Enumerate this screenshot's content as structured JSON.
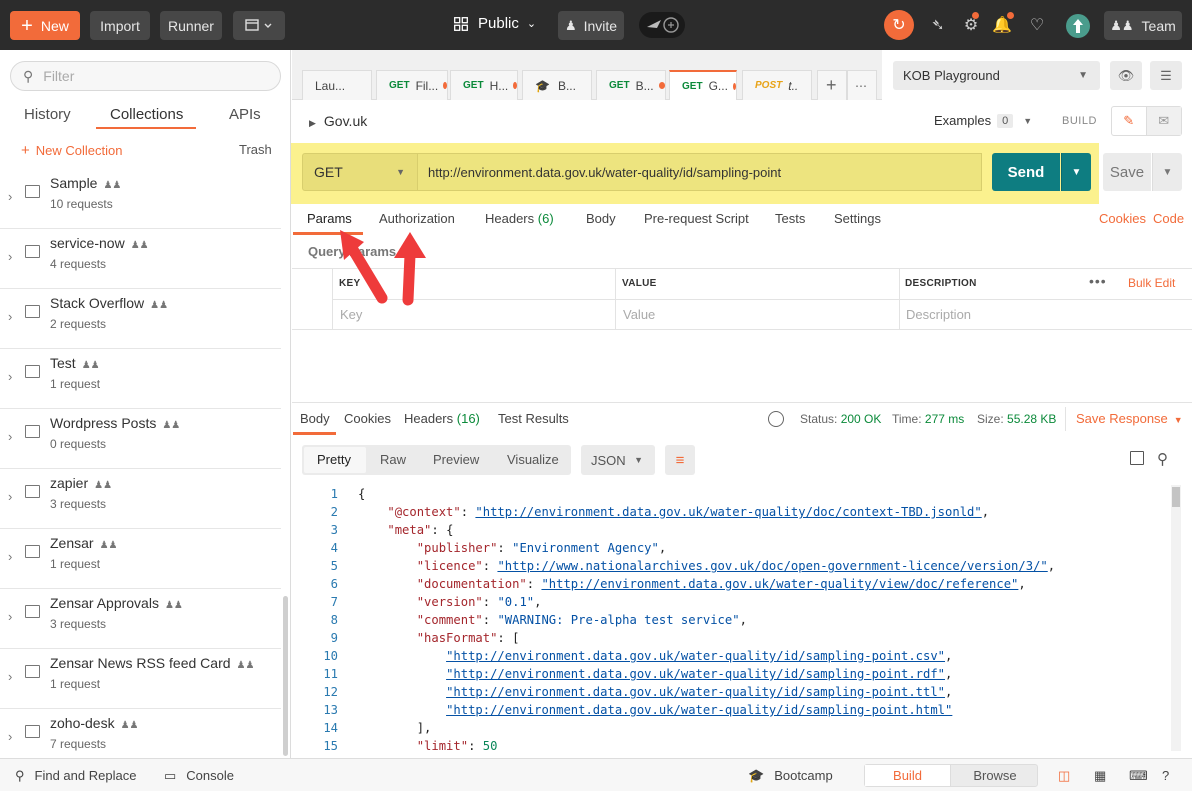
{
  "topbar": {
    "new_label": "New",
    "import_label": "Import",
    "runner_label": "Runner",
    "workspace_label": "Public",
    "invite_label": "Invite",
    "team_label": "Team",
    "accent": "#f26b3a"
  },
  "sidebar": {
    "filter_placeholder": "Filter",
    "tabs": [
      {
        "label": "History"
      },
      {
        "label": "Collections"
      },
      {
        "label": "APIs"
      }
    ],
    "new_collection_label": "New Collection",
    "trash_label": "Trash",
    "collections": [
      {
        "name": "Sample",
        "count": "10 requests"
      },
      {
        "name": "service-now",
        "count": "4 requests"
      },
      {
        "name": "Stack Overflow",
        "count": "2 requests"
      },
      {
        "name": "Test",
        "count": "1 request"
      },
      {
        "name": "Wordpress Posts",
        "count": "0 requests"
      },
      {
        "name": "zapier",
        "count": "3 requests"
      },
      {
        "name": "Zensar",
        "count": "1 request"
      },
      {
        "name": "Zensar Approvals",
        "count": "3 requests"
      },
      {
        "name": "Zensar News RSS feed Card",
        "count": "1 request"
      },
      {
        "name": "zoho-desk",
        "count": "7 requests"
      }
    ]
  },
  "request_tabs": [
    {
      "method": "",
      "label": "Lau..."
    },
    {
      "method": "GET",
      "label": "Fil..."
    },
    {
      "method": "GET",
      "label": "H..."
    },
    {
      "method": "",
      "label": "B..."
    },
    {
      "method": "GET",
      "label": "B..."
    },
    {
      "method": "GET",
      "label": "G..."
    },
    {
      "method": "POST",
      "label": "t.."
    }
  ],
  "environment": {
    "selected": "KOB Playground"
  },
  "request": {
    "name": "Gov.uk",
    "examples_label": "Examples",
    "examples_count": "0",
    "build_label": "BUILD",
    "method": "GET",
    "url": "http://environment.data.gov.uk/water-quality/id/sampling-point",
    "send_label": "Send",
    "save_label": "Save",
    "tabs": [
      {
        "label": "Params"
      },
      {
        "label": "Authorization"
      },
      {
        "label": "Headers",
        "count": "(6)"
      },
      {
        "label": "Body"
      },
      {
        "label": "Pre-request Script"
      },
      {
        "label": "Tests"
      },
      {
        "label": "Settings"
      }
    ],
    "cookies_label": "Cookies",
    "code_label": "Code",
    "query_params_label": "Query Params",
    "table_headers": [
      "KEY",
      "VALUE",
      "DESCRIPTION"
    ],
    "table_placeholders": [
      "Key",
      "Value",
      "Description"
    ],
    "bulk_edit_label": "Bulk Edit"
  },
  "response": {
    "tabs": [
      {
        "label": "Body"
      },
      {
        "label": "Cookies"
      },
      {
        "label": "Headers",
        "count": "(16)"
      },
      {
        "label": "Test Results"
      }
    ],
    "status_label": "Status:",
    "status_value": "200 OK",
    "time_label": "Time:",
    "time_value": "277 ms",
    "size_label": "Size:",
    "size_value": "55.28 KB",
    "save_response_label": "Save Response",
    "views": [
      "Pretty",
      "Raw",
      "Preview",
      "Visualize"
    ],
    "format": "JSON",
    "lines": [
      {
        "n": "1",
        "text": "{"
      },
      {
        "n": "2",
        "key": "\"@context\"",
        "url": "\"http://environment.data.gov.uk/water-quality/doc/context-TBD.jsonld\"",
        "tail": ","
      },
      {
        "n": "3",
        "key": "\"meta\"",
        "tail": " {"
      },
      {
        "n": "4",
        "key": "\"publisher\"",
        "str": "\"Environment Agency\"",
        "tail": ","
      },
      {
        "n": "5",
        "key": "\"licence\"",
        "url": "\"http://www.nationalarchives.gov.uk/doc/open-government-licence/version/3/\"",
        "tail": ","
      },
      {
        "n": "6",
        "key": "\"documentation\"",
        "url": "\"http://environment.data.gov.uk/water-quality/view/doc/reference\"",
        "tail": ","
      },
      {
        "n": "7",
        "key": "\"version\"",
        "str": "\"0.1\"",
        "tail": ","
      },
      {
        "n": "8",
        "key": "\"comment\"",
        "str": "\"WARNING: Pre-alpha test service\"",
        "tail": ","
      },
      {
        "n": "9",
        "key": "\"hasFormat\"",
        "tail": " ["
      },
      {
        "n": "10",
        "url": "\"http://environment.data.gov.uk/water-quality/id/sampling-point.csv\"",
        "tail": ","
      },
      {
        "n": "11",
        "url": "\"http://environment.data.gov.uk/water-quality/id/sampling-point.rdf\"",
        "tail": ","
      },
      {
        "n": "12",
        "url": "\"http://environment.data.gov.uk/water-quality/id/sampling-point.ttl\"",
        "tail": ","
      },
      {
        "n": "13",
        "url": "\"http://environment.data.gov.uk/water-quality/id/sampling-point.html\"",
        "tail": ""
      },
      {
        "n": "14",
        "text": "],"
      },
      {
        "n": "15",
        "key": "\"limit\"",
        "num": "50"
      }
    ]
  },
  "statusbar": {
    "find_replace_label": "Find and Replace",
    "console_label": "Console",
    "bootcamp_label": "Bootcamp",
    "build_label": "Build",
    "browse_label": "Browse"
  }
}
